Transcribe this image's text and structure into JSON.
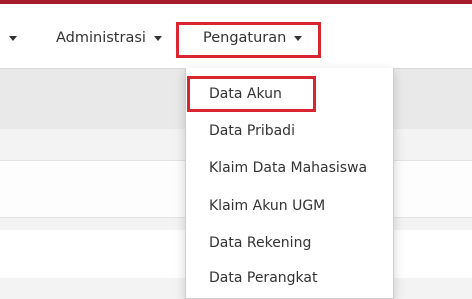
{
  "navbar": {
    "items": [
      {
        "label": ""
      },
      {
        "label": "Administrasi"
      },
      {
        "label": "Pengaturan"
      }
    ]
  },
  "dropdown": {
    "items": [
      {
        "label": "Data Akun"
      },
      {
        "label": "Data Pribadi"
      },
      {
        "label": "Klaim Data Mahasiswa"
      },
      {
        "label": "Klaim Akun UGM"
      },
      {
        "label": "Data Rekening"
      },
      {
        "label": "Data Perangkat"
      }
    ]
  },
  "colors": {
    "top_bar": "#a51c2a",
    "highlight_box": "#d9252f"
  }
}
